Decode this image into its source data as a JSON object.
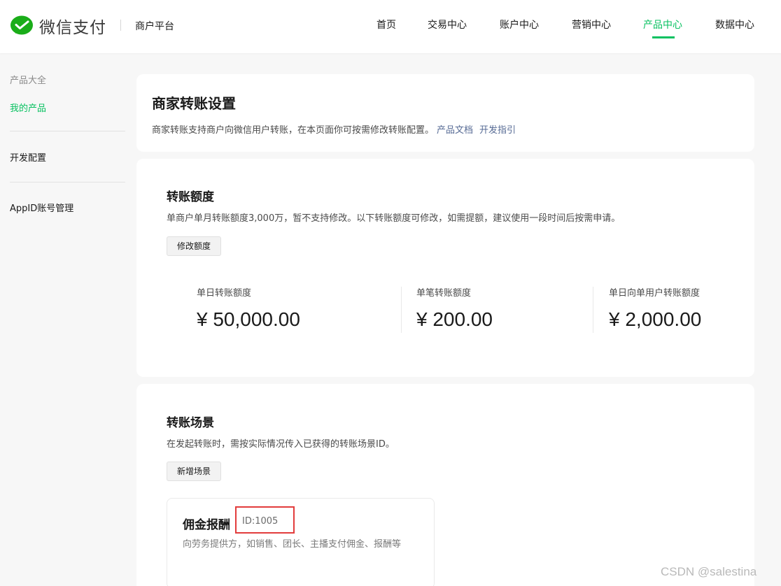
{
  "header": {
    "brand": "微信支付",
    "platform": "商户平台",
    "nav": [
      {
        "label": "首页"
      },
      {
        "label": "交易中心"
      },
      {
        "label": "账户中心"
      },
      {
        "label": "营销中心"
      },
      {
        "label": "产品中心"
      },
      {
        "label": "数据中心"
      }
    ],
    "active_index": 4
  },
  "sidebar": {
    "group_title": "产品大全",
    "items": [
      {
        "label": "我的产品"
      },
      {
        "label": "开发配置"
      },
      {
        "label": "AppID账号管理"
      }
    ]
  },
  "intro": {
    "title": "商家转账设置",
    "desc": "商家转账支持商户向微信用户转账，在本页面你可按需修改转账配置。",
    "link_doc": "产品文档",
    "link_dev": "开发指引"
  },
  "quota": {
    "title": "转账额度",
    "desc": "单商户单月转账额度3,000万，暂不支持修改。以下转账额度可修改，如需提额，建议使用一段时间后按需申请。",
    "button": "修改额度",
    "stats": [
      {
        "label": "单日转账额度",
        "value": "¥ 50,000.00"
      },
      {
        "label": "单笔转账额度",
        "value": "¥ 200.00"
      },
      {
        "label": "单日向单用户转账额度",
        "value": "¥ 2,000.00"
      }
    ]
  },
  "scenes": {
    "title": "转账场景",
    "desc": "在发起转账时，需按实际情况传入已获得的转账场景ID。",
    "button": "新增场景",
    "items": [
      {
        "name": "佣金报酬",
        "id": "ID:1005",
        "desc": "向劳务提供方，如销售、团长、主播支付佣金、报酬等"
      }
    ]
  },
  "watermark": "CSDN @salestina",
  "colors": {
    "accent": "#07c160",
    "link": "#576b95",
    "highlight": "#e23c3c"
  }
}
